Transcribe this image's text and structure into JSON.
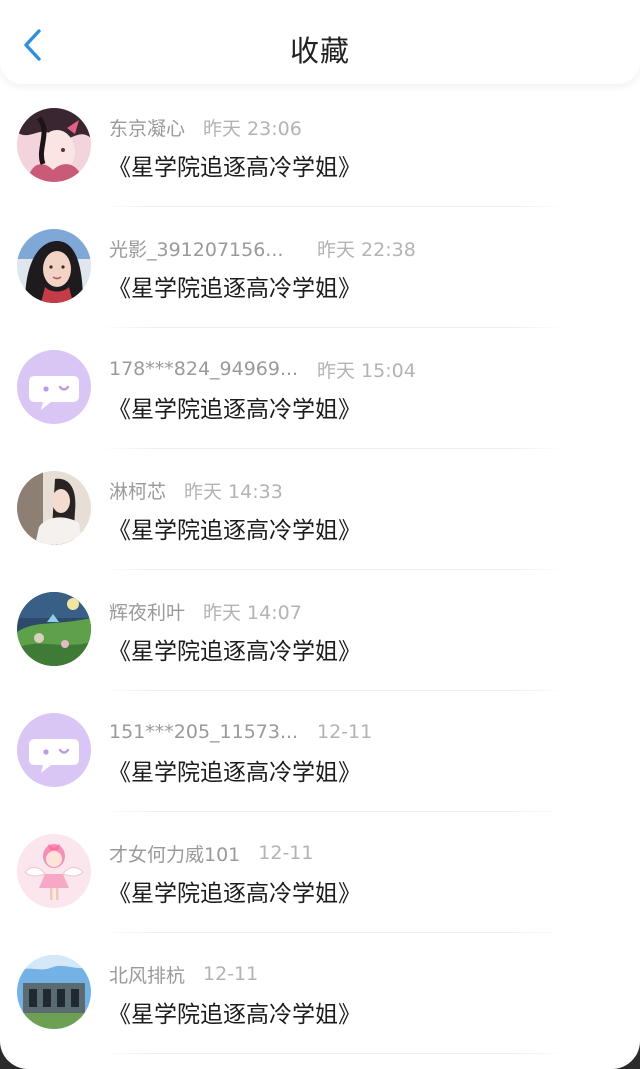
{
  "header": {
    "title": "收藏",
    "back_icon": "chevron-left-icon",
    "accent_color": "#2f8fde"
  },
  "items": [
    {
      "name": "东京凝心",
      "time": "昨天 23:06",
      "book": "《星学院追逐高冷学姐》",
      "avatar": "anime-girl-avatar"
    },
    {
      "name": "光影_391207156...",
      "time": "昨天 22:38",
      "book": "《星学院追逐高冷学姐》",
      "avatar": "photo-avatar"
    },
    {
      "name": "178***824_94969...",
      "time": "昨天 15:04",
      "book": "《星学院追逐高冷学姐》",
      "avatar": "default-chat-bubble-avatar"
    },
    {
      "name": "淋柯芯",
      "time": "昨天 14:33",
      "book": "《星学院追逐高冷学姐》",
      "avatar": "photo-avatar"
    },
    {
      "name": "辉夜利叶",
      "time": "昨天 14:07",
      "book": "《星学院追逐高冷学姐》",
      "avatar": "landscape-avatar"
    },
    {
      "name": "151***205_11573...",
      "time": "12-11",
      "book": "《星学院追逐高冷学姐》",
      "avatar": "default-chat-bubble-avatar"
    },
    {
      "name": "才女何力威101",
      "time": "12-11",
      "book": "《星学院追逐高冷学姐》",
      "avatar": "angel-girl-avatar"
    },
    {
      "name": "北风排杭",
      "time": "12-11",
      "book": "《星学院追逐高冷学姐》",
      "avatar": "building-avatar"
    }
  ],
  "colors": {
    "default_avatar_bg": "#d9c6f5",
    "meta_text": "#a2a2a2",
    "title_text": "#1c1c1c"
  }
}
